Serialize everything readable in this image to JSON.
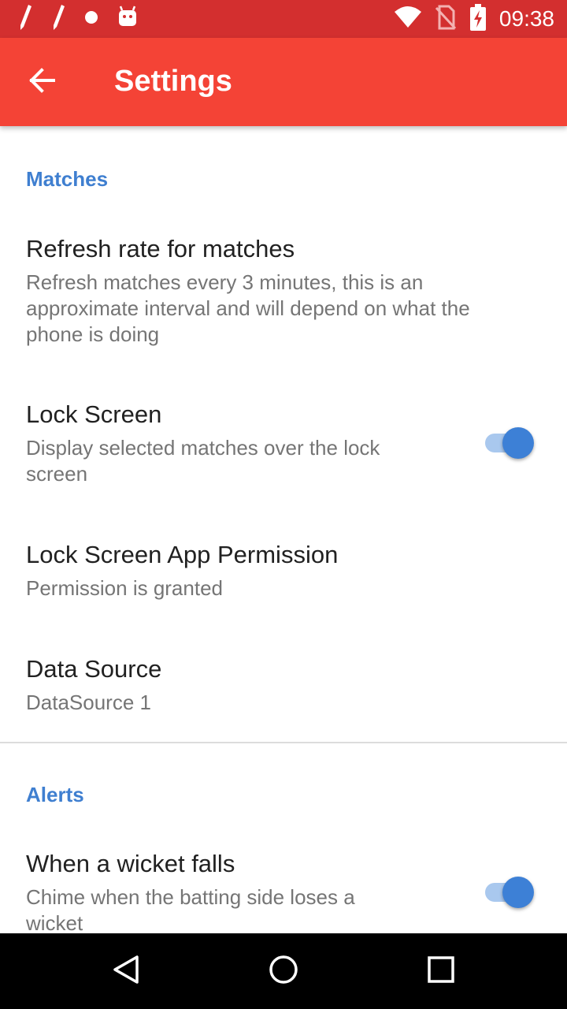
{
  "status_bar": {
    "time": "09:38",
    "icons_left": [
      "pen-icon",
      "pen-icon",
      "dot-icon",
      "android-icon"
    ],
    "icons_right": [
      "wifi-icon",
      "no-sim-icon",
      "battery-charging-icon"
    ]
  },
  "app_bar": {
    "title": "Settings",
    "back_icon": "arrow-back-icon"
  },
  "sections": {
    "matches": {
      "header": "Matches",
      "refresh_rate": {
        "title": "Refresh rate for matches",
        "summary": "Refresh matches every 3 minutes, this is an approximate interval and will depend on what the phone is doing"
      },
      "lock_screen": {
        "title": "Lock Screen",
        "summary": "Display selected matches over the lock screen",
        "enabled": true
      },
      "lock_screen_permission": {
        "title": "Lock Screen App Permission",
        "summary": "Permission is granted"
      },
      "data_source": {
        "title": "Data Source",
        "summary": "DataSource 1"
      }
    },
    "alerts": {
      "header": "Alerts",
      "wicket_falls": {
        "title": "When a wicket falls",
        "summary": "Chime when the batting side loses a wicket",
        "enabled": true
      }
    }
  },
  "nav_bar": {
    "back": "nav-back-icon",
    "home": "nav-home-icon",
    "recents": "nav-recents-icon"
  },
  "colors": {
    "status_bar": "#D32F2F",
    "app_bar": "#F44336",
    "accent": "#3D80D6",
    "category_text": "#3F7FD0"
  }
}
